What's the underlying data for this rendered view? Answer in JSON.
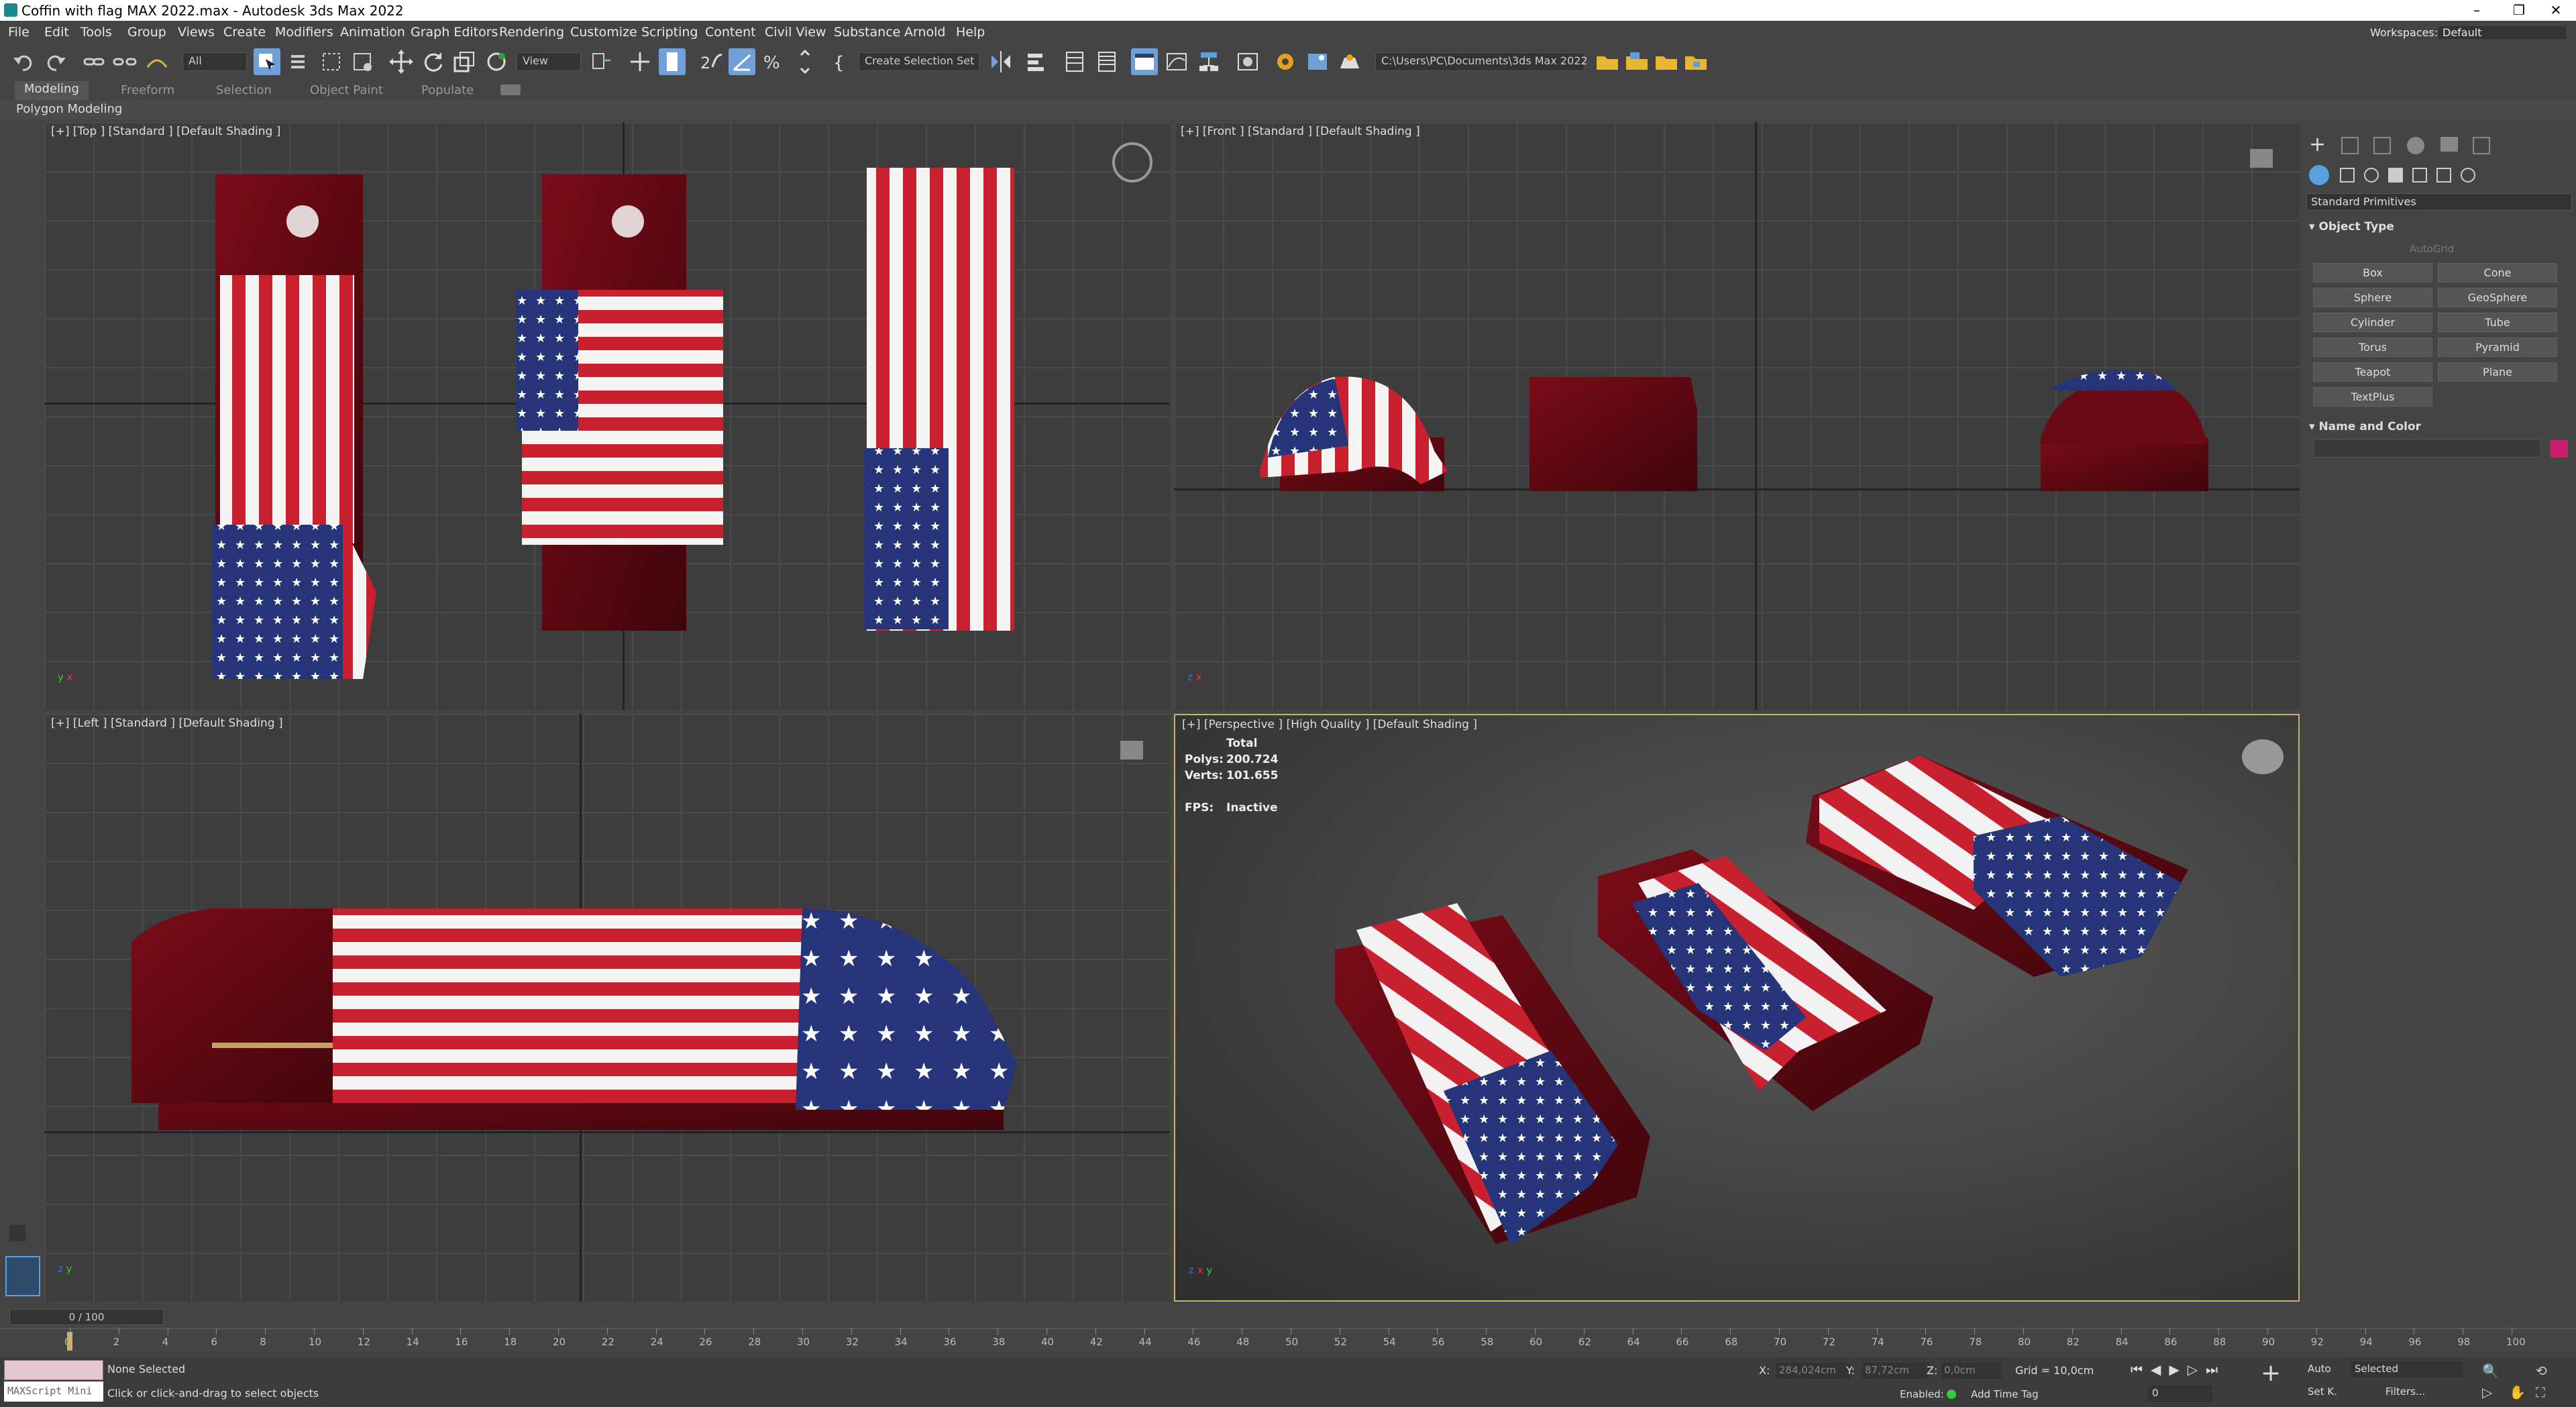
{
  "window": {
    "title": "Coffin with flag MAX 2022.max - Autodesk 3ds Max 2022",
    "controls": [
      "–",
      "❐",
      "✕"
    ]
  },
  "menu": [
    "File",
    "Edit",
    "Tools",
    "Group",
    "Views",
    "Create",
    "Modifiers",
    "Animation",
    "Graph Editors",
    "Rendering",
    "Customize",
    "Scripting",
    "Content",
    "Civil View",
    "Substance",
    "Arnold",
    "Help"
  ],
  "workspaces": {
    "label": "Workspaces:",
    "value": "Default"
  },
  "toolbar": {
    "filter": "All",
    "refcoord": "View",
    "selset": "Create Selection Set",
    "path": "C:\\Users\\PC\\Documents\\3ds Max 2022"
  },
  "ribbon": {
    "tabs": [
      "Modeling",
      "Freeform",
      "Selection",
      "Object Paint",
      "Populate"
    ],
    "subtitle": "Polygon Modeling"
  },
  "viewports": {
    "top": {
      "label": "[+] [Top ] [Standard ] [Default Shading ]"
    },
    "front": {
      "label": "[+] [Front ] [Standard ] [Default Shading ]"
    },
    "left": {
      "label": "[+] [Left ] [Standard ] [Default Shading ]"
    },
    "persp": {
      "label": "[+] [Perspective ] [High Quality ] [Default Shading ]",
      "stats_header": "Total",
      "polys_label": "Polys:",
      "polys": "200.724",
      "verts_label": "Verts:",
      "verts": "101.655",
      "fps_label": "FPS:",
      "fps": "Inactive"
    }
  },
  "axis": {
    "x": "x",
    "y": "y",
    "z": "z"
  },
  "cmdpanel": {
    "category": "Standard Primitives",
    "object_type": "Object Type",
    "autogrid": "AutoGrid",
    "buttons": [
      "Box",
      "Cone",
      "Sphere",
      "GeoSphere",
      "Cylinder",
      "Tube",
      "Torus",
      "Pyramid",
      "Teapot",
      "Plane",
      "TextPlus"
    ],
    "name_color": "Name and Color",
    "swatch": "#cc1e6e"
  },
  "timeline": {
    "frame": "0 / 100",
    "ticks": [
      "0",
      "2",
      "4",
      "6",
      "8",
      "10",
      "12",
      "14",
      "16",
      "18",
      "20",
      "22",
      "24",
      "26",
      "28",
      "30",
      "32",
      "34",
      "36",
      "38",
      "40",
      "42",
      "44",
      "46",
      "48",
      "50",
      "52",
      "54",
      "56",
      "58",
      "60",
      "62",
      "64",
      "66",
      "68",
      "70",
      "72",
      "74",
      "76",
      "78",
      "80",
      "82",
      "84",
      "86",
      "88",
      "90",
      "92",
      "94",
      "96",
      "98",
      "100"
    ]
  },
  "status": {
    "maxscript": "MAXScript Mini",
    "selection": "None Selected",
    "prompt": "Click or click-and-drag to select objects",
    "x_label": "X:",
    "x": "284,024cm",
    "y_label": "Y:",
    "y": "87,72cm",
    "z_label": "Z:",
    "z": "0,0cm",
    "grid": "Grid = 10,0cm",
    "enabled": "Enabled:",
    "addtime": "Add Time Tag",
    "auto": "Auto",
    "selected": "Selected",
    "setk": "Set K.",
    "filters": "Filters...",
    "framefield": "0"
  }
}
